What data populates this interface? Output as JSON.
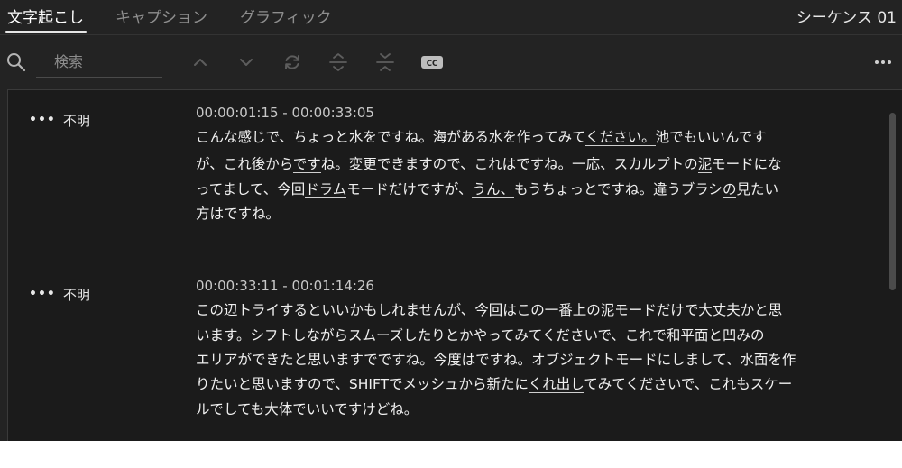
{
  "tabs": [
    {
      "label": "文字起こし",
      "active": true
    },
    {
      "label": "キャプション",
      "active": false
    },
    {
      "label": "グラフィック",
      "active": false
    }
  ],
  "sequence_name": "シーケンス 01",
  "search": {
    "placeholder": "検索"
  },
  "toolbar": {
    "icons": [
      "chevron-up-icon",
      "chevron-down-icon",
      "refresh-icon",
      "split-icon",
      "merge-icon",
      "closed-caption-icon",
      "more-horizontal-icon"
    ],
    "cc_label": "CC"
  },
  "segments": [
    {
      "speaker": "不明",
      "timecode": "00:00:01:15 - 00:00:33:05",
      "lines": [
        [
          {
            "t": "こんな感じで、ちょっと水をですね。海がある水を作ってみて"
          },
          {
            "t": "ください。",
            "u": true
          },
          {
            "t": "池でもいいんです"
          }
        ],
        [
          {
            "t": "が、これ後から"
          },
          {
            "t": "です",
            "u": true
          },
          {
            "t": "ね。変更できますので、これはですね。一応、スカルプトの"
          },
          {
            "t": "泥",
            "u": true
          },
          {
            "t": "モードにな"
          }
        ],
        [
          {
            "t": "ってまして、今回"
          },
          {
            "t": "ドラム",
            "u": true
          },
          {
            "t": "モードだけですが、"
          },
          {
            "t": "うん、",
            "u": true
          },
          {
            "t": "もうちょっとですね。違うブラシ"
          },
          {
            "t": "の",
            "u": true
          },
          {
            "t": "見たい"
          }
        ],
        [
          {
            "t": "方はですね。"
          }
        ]
      ]
    },
    {
      "speaker": "不明",
      "timecode": "00:00:33:11 - 00:01:14:26",
      "lines": [
        [
          {
            "t": "この辺トライするといいかもしれませんが、今回はこの一番上の泥モードだけで大丈夫かと思"
          }
        ],
        [
          {
            "t": "います。シフトしながらスムーズし"
          },
          {
            "t": "たり",
            "u": true
          },
          {
            "t": "とかやってみてくださいで、これで和平面と"
          },
          {
            "t": "凹み",
            "u": true
          },
          {
            "t": "の"
          }
        ],
        [
          {
            "t": "エリアができたと思いますでですね。今度はですね。オブジェクトモードにしまして、水面を作"
          }
        ],
        [
          {
            "t": "りたいと思いますので、SHIFTでメッシュから新たに"
          },
          {
            "t": "くれ出し",
            "u": true
          },
          {
            "t": "てみてくださいで、これもスケー"
          }
        ],
        [
          {
            "t": "ルでしても大体でいいですけどね。"
          }
        ]
      ]
    }
  ]
}
